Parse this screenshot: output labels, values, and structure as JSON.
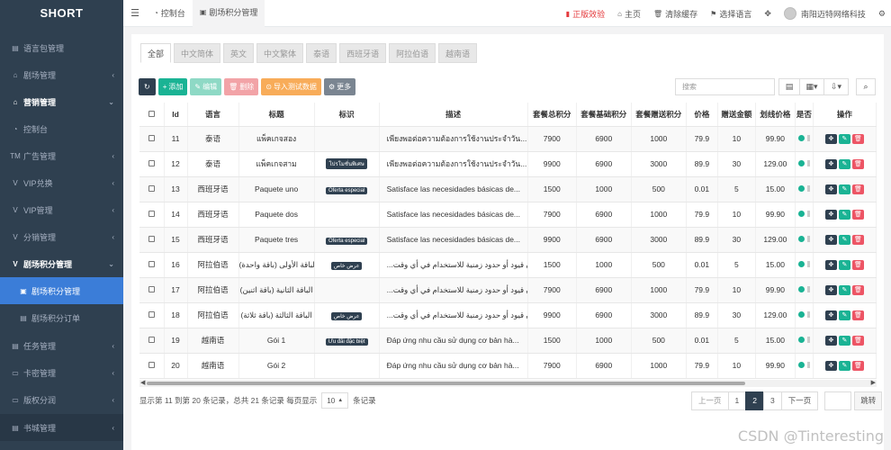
{
  "sidebar": {
    "brand": "SHORT",
    "items": [
      {
        "icon": "book",
        "label": "语言包管理",
        "chev": ""
      },
      {
        "icon": "home",
        "label": "剧场管理",
        "chev": "‹"
      },
      {
        "icon": "home",
        "label": "营销管理",
        "chev": "⌄"
      },
      {
        "icon": "gauge",
        "label": "控制台",
        "chev": ""
      },
      {
        "icon": "TM",
        "label": "广告管理",
        "chev": "‹"
      },
      {
        "icon": "v",
        "label": "VIP兑换",
        "chev": "‹"
      },
      {
        "icon": "v",
        "label": "VIP管理",
        "chev": "‹"
      },
      {
        "icon": "v",
        "label": "分销管理",
        "chev": "‹"
      },
      {
        "icon": "v",
        "label": "剧场积分管理",
        "chev": "⌄"
      },
      {
        "icon": "v-square",
        "label": "剧场积分管理",
        "chev": ""
      },
      {
        "icon": "file",
        "label": "剧场积分订单",
        "chev": ""
      },
      {
        "icon": "file",
        "label": "任务管理",
        "chev": "‹"
      },
      {
        "icon": "card",
        "label": "卡密管理",
        "chev": "‹"
      },
      {
        "icon": "card",
        "label": "版权分润",
        "chev": "‹"
      },
      {
        "icon": "book",
        "label": "书城管理",
        "chev": "‹"
      }
    ]
  },
  "topbar": {
    "tabs": [
      {
        "icon": "gauge",
        "label": "控制台"
      },
      {
        "icon": "v-square",
        "label": "剧场积分管理"
      }
    ],
    "right": {
      "genuine": "正版效验",
      "home": "主页",
      "clear_cache": "清除缓存",
      "language": "选择语言",
      "user": "南阳迈特网络科技"
    }
  },
  "lang_tabs": [
    "全部",
    "中文简体",
    "英文",
    "中文繁体",
    "泰语",
    "西班牙语",
    "阿拉伯语",
    "越南语"
  ],
  "toolbar": {
    "add": "添加",
    "edit": "编辑",
    "delete": "删除",
    "import": "导入测试数据",
    "more": "更多"
  },
  "search": {
    "placeholder": "搜索"
  },
  "table": {
    "headers": [
      "Id",
      "语言",
      "标题",
      "标识",
      "描述",
      "套餐总积分",
      "套餐基础积分",
      "套餐赠送积分",
      "价格",
      "赠送金额",
      "划线价格",
      "是否",
      "操作"
    ],
    "rows": [
      {
        "id": "11",
        "lang": "泰语",
        "title": "แพ็คเกจสอง",
        "tag": "",
        "desc": "เพียงพอต่อความต้องการใช้งานประจำวัน...",
        "total": "7900",
        "base": "6900",
        "gift": "1000",
        "price": "79.9",
        "bonus": "10",
        "strike": "99.90"
      },
      {
        "id": "12",
        "lang": "泰语",
        "title": "แพ็คเกจสาม",
        "tag": "โปรโมชั่นพิเศษ",
        "desc": "เพียงพอต่อความต้องการใช้งานประจำวัน...",
        "total": "9900",
        "base": "6900",
        "gift": "3000",
        "price": "89.9",
        "bonus": "30",
        "strike": "129.00"
      },
      {
        "id": "13",
        "lang": "西班牙语",
        "title": "Paquete uno",
        "tag": "Oferta especial",
        "desc": "Satisface las necesidades básicas de...",
        "total": "1500",
        "base": "1000",
        "gift": "500",
        "price": "0.01",
        "bonus": "5",
        "strike": "15.00"
      },
      {
        "id": "14",
        "lang": "西班牙语",
        "title": "Paquete dos",
        "tag": "",
        "desc": "Satisface las necesidades básicas de...",
        "total": "7900",
        "base": "6900",
        "gift": "1000",
        "price": "79.9",
        "bonus": "10",
        "strike": "99.90"
      },
      {
        "id": "15",
        "lang": "西班牙语",
        "title": "Paquete tres",
        "tag": "Oferta especial",
        "desc": "Satisface las necesidades básicas de...",
        "total": "9900",
        "base": "6900",
        "gift": "3000",
        "price": "89.9",
        "bonus": "30",
        "strike": "129.00"
      },
      {
        "id": "16",
        "lang": "阿拉伯语",
        "title": "الباقة الأولى (باقة واحدة)",
        "tag": "عرض خاص",
        "desc": "...فقط، دون قيود أو حدود زمنية للاستخدام في أي وقت",
        "total": "1500",
        "base": "1000",
        "gift": "500",
        "price": "0.01",
        "bonus": "5",
        "strike": "15.00"
      },
      {
        "id": "17",
        "lang": "阿拉伯语",
        "title": "الباقة الثانية (باقة اثنين)",
        "tag": "",
        "desc": "...فقط، دون قيود أو حدود زمنية للاستخدام في أي وقت",
        "total": "7900",
        "base": "6900",
        "gift": "1000",
        "price": "79.9",
        "bonus": "10",
        "strike": "99.90"
      },
      {
        "id": "18",
        "lang": "阿拉伯语",
        "title": "الباقة الثالثة (باقة ثلاثة)",
        "tag": "عرض خاص",
        "desc": "...فقط، دون قيود أو حدود زمنية للاستخدام في أي وقت",
        "total": "9900",
        "base": "6900",
        "gift": "3000",
        "price": "89.9",
        "bonus": "30",
        "strike": "129.00"
      },
      {
        "id": "19",
        "lang": "越南语",
        "title": "Gói 1",
        "tag": "Ưu đãi đặc biệt",
        "desc": "Đáp ứng nhu cầu sử dụng cơ bản hà...",
        "total": "1500",
        "base": "1000",
        "gift": "500",
        "price": "0.01",
        "bonus": "5",
        "strike": "15.00"
      },
      {
        "id": "20",
        "lang": "越南语",
        "title": "Gói 2",
        "tag": "",
        "desc": "Đáp ứng nhu cầu sử dụng cơ bản hà...",
        "total": "7900",
        "base": "6900",
        "gift": "1000",
        "price": "79.9",
        "bonus": "10",
        "strike": "99.90"
      }
    ]
  },
  "pagination": {
    "info_prefix": "显示第 11 到第 20 条记录，总共 21 条记录 每页显示",
    "page_size": "10",
    "info_suffix": "条记录",
    "prev": "上一页",
    "pages": [
      "1",
      "2",
      "3"
    ],
    "current": "2",
    "next": "下一页",
    "jump": "跳转"
  },
  "watermark": "CSDN @Tinteresting",
  "colors": {
    "sidebar_bg": "#2f4050",
    "accent_blue": "#3b7dd8",
    "green": "#1ab394",
    "red": "#ed5565",
    "orange": "#f8ac59"
  }
}
